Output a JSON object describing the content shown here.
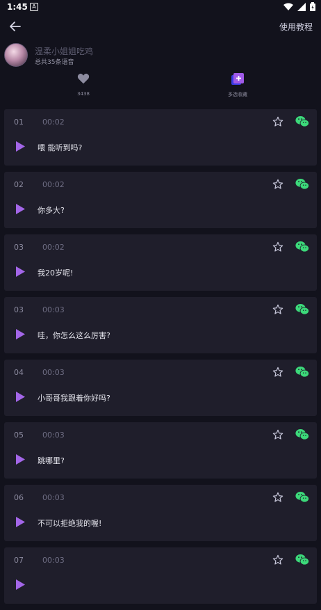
{
  "status_bar": {
    "time": "1:45",
    "notification_icon": "A"
  },
  "header": {
    "back_icon": "arrow-left-icon",
    "tutorial_label": "使用教程"
  },
  "profile": {
    "name": "温柔小姐姐吃鸡",
    "count_text": "总共35条语音"
  },
  "stats": {
    "likes": {
      "icon": "heart-icon",
      "value": "3438"
    },
    "collect": {
      "icon": "multi-select-collect-icon",
      "label": "多选收藏"
    }
  },
  "colors": {
    "play": "#a366e8",
    "wechat": "#3cd97a",
    "star": "#c9c9dc",
    "card": "#1f1e2b"
  },
  "voices": [
    {
      "num": "01",
      "duration": "00:02",
      "text": "喂 能听到吗?"
    },
    {
      "num": "02",
      "duration": "00:02",
      "text": "你多大?"
    },
    {
      "num": "03",
      "duration": "00:02",
      "text": "我20岁呢!"
    },
    {
      "num": "03",
      "duration": "00:03",
      "text": "哇，你怎么这么厉害?"
    },
    {
      "num": "04",
      "duration": "00:03",
      "text": "小哥哥我跟着你好吗?"
    },
    {
      "num": "05",
      "duration": "00:03",
      "text": "跳哪里?"
    },
    {
      "num": "06",
      "duration": "00:03",
      "text": "不可以拒绝我的喔!"
    },
    {
      "num": "07",
      "duration": "00:03",
      "text": ""
    }
  ]
}
